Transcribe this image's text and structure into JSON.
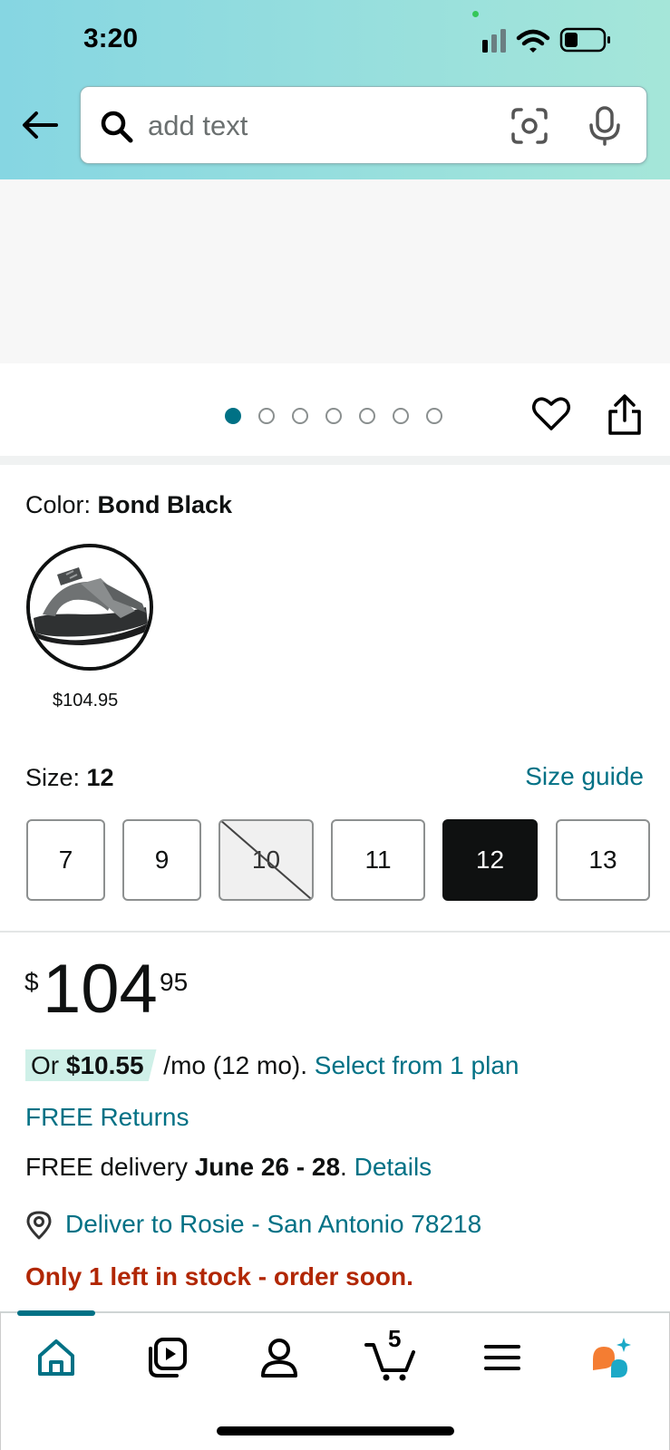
{
  "status_bar": {
    "time": "3:20"
  },
  "search": {
    "placeholder": "add text"
  },
  "carousel": {
    "total_images": 7,
    "active_index": 0
  },
  "color": {
    "label": "Color: ",
    "value": "Bond Black",
    "swatch_price": "$104.95"
  },
  "size": {
    "label": "Size: ",
    "value": "12",
    "guide_link": "Size guide",
    "options": [
      {
        "label": "7",
        "state": "available"
      },
      {
        "label": "9",
        "state": "available"
      },
      {
        "label": "10",
        "state": "unavailable"
      },
      {
        "label": "11",
        "state": "available"
      },
      {
        "label": "12",
        "state": "selected"
      },
      {
        "label": "13",
        "state": "available"
      }
    ]
  },
  "price": {
    "symbol": "$",
    "whole": "104",
    "fraction": "95",
    "monthly_prefix": "Or ",
    "monthly_amount": "$10.55",
    "monthly_term": " /mo (12 mo). ",
    "plan_link": "Select from 1 plan"
  },
  "returns": {
    "text": "FREE Returns"
  },
  "delivery": {
    "prefix": "FREE delivery ",
    "dates": "June 26 - 28",
    "dot": ". ",
    "details_link": "Details",
    "deliver_to": "Deliver to Rosie - San Antonio 78218"
  },
  "stock": {
    "text": "Only 1 left in stock - order soon."
  },
  "bottom_nav": {
    "cart_count": "5",
    "items": [
      "home",
      "inspire",
      "account",
      "cart",
      "menu",
      "rufus"
    ]
  },
  "colors": {
    "accent": "#007185",
    "stock_warning": "#b12704",
    "header_gradient_start": "#86d6e2",
    "header_gradient_end": "#a5e6d9",
    "rufus_orange": "#f47d32"
  }
}
